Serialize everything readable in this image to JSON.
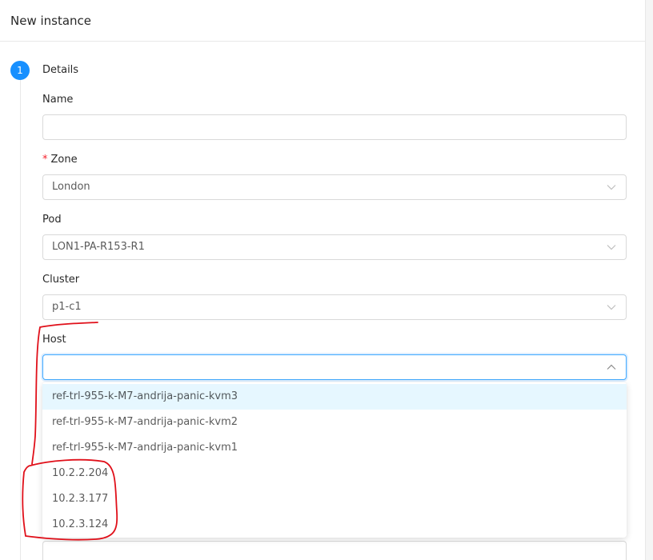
{
  "header": {
    "title": "New instance"
  },
  "step": {
    "number": "1",
    "title": "Details"
  },
  "form": {
    "name": {
      "label": "Name",
      "value": ""
    },
    "zone": {
      "required_mark": "*",
      "label": "Zone",
      "value": "London"
    },
    "pod": {
      "label": "Pod",
      "value": "LON1-PA-R153-R1"
    },
    "cluster": {
      "label": "Cluster",
      "value": "p1-c1"
    },
    "host": {
      "label": "Host",
      "value": "",
      "options": [
        "ref-trl-955-k-M7-andrija-panic-kvm3",
        "ref-trl-955-k-M7-andrija-panic-kvm2",
        "ref-trl-955-k-M7-andrija-panic-kvm1",
        "10.2.2.204",
        "10.2.3.177",
        "10.2.3.124"
      ]
    }
  },
  "colors": {
    "primary": "#1890ff",
    "option_active_bg": "#e6f7ff",
    "required": "#f5222d",
    "annotation": "#e0101a"
  },
  "icons": {
    "select_arrow": "chevron-down-icon",
    "open_select_arrow": "chevron-up-icon"
  }
}
